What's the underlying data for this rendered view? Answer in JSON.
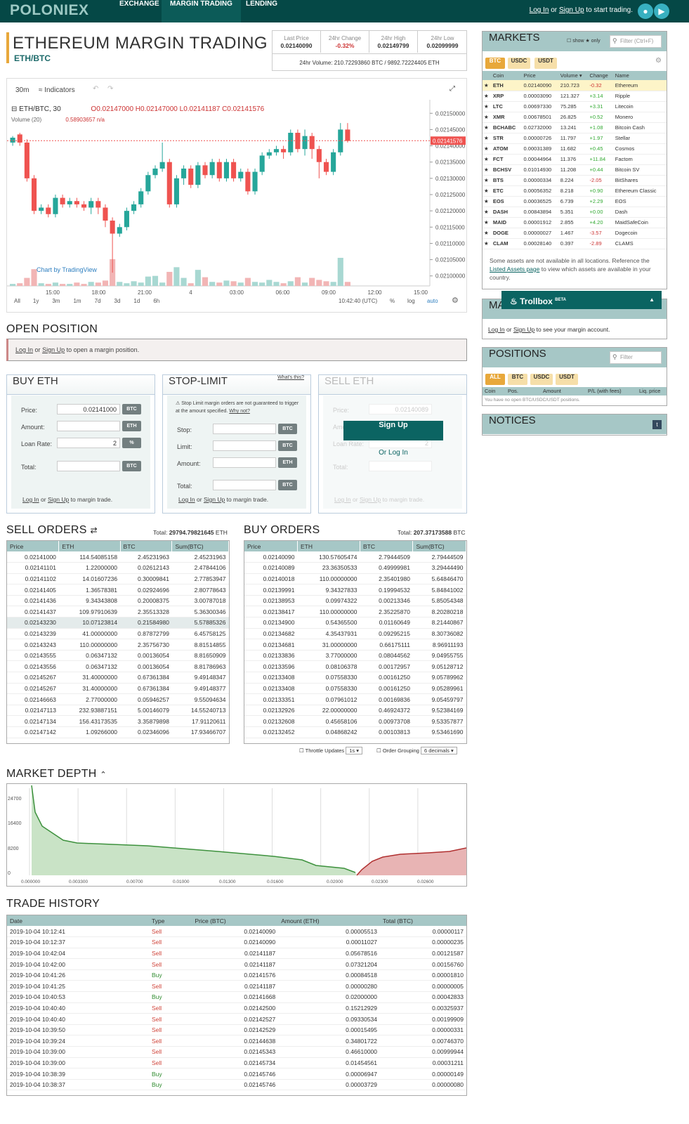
{
  "nav": {
    "logo": "POLONIEX",
    "tabs": [
      "EXCHANGE",
      "MARGIN TRADING",
      "LENDING"
    ],
    "login": "Log In",
    "or": "or",
    "signup": "Sign Up",
    "login_suffix": "to start trading."
  },
  "header": {
    "title": "ETHEREUM MARGIN TRADING",
    "pair": "ETH/BTC",
    "stats": [
      {
        "label": "Last Price",
        "value": "0.02140090"
      },
      {
        "label": "24hr Change",
        "value": "-0.32%"
      },
      {
        "label": "24hr High",
        "value": "0.02149799"
      },
      {
        "label": "24hr Low",
        "value": "0.02099999"
      }
    ],
    "volume": "24hr Volume: 210.72293860 BTC / 9892.72224405 ETH"
  },
  "chart": {
    "interval": "30m",
    "indicators": "Indicators",
    "legend": "ETH/BTC, 30",
    "ohlc": "O0.02147000 H0.02147000 L0.02141187 C0.02141576",
    "volume_label": "Volume (20)",
    "volume_val": "0.58903657 n/a",
    "current_price": "0.02141576",
    "credit": "Chart by TradingView",
    "yticks": [
      "0.02150000",
      "0.02145000",
      "0.02140000",
      "0.02135000",
      "0.02130000",
      "0.02125000",
      "0.02120000",
      "0.02115000",
      "0.02110000",
      "0.02105000",
      "0.02100000"
    ],
    "xticks": [
      "15:00",
      "18:00",
      "21:00",
      "4",
      "03:00",
      "06:00",
      "09:00",
      "12:00",
      "15:00"
    ],
    "ranges": [
      "All",
      "1y",
      "3m",
      "1m",
      "7d",
      "3d",
      "1d",
      "6h"
    ],
    "clock": "10:42:40 (UTC)",
    "pct": "%",
    "log": "log",
    "auto": "auto"
  },
  "open_position": {
    "title": "OPEN POSITION",
    "login": "Log In",
    "or": "or",
    "signup": "Sign Up",
    "text": "to open a margin position."
  },
  "buy": {
    "title": "BUY ETH",
    "price_label": "Price:",
    "price": "0.02141000",
    "amount_label": "Amount:",
    "loan_label": "Loan Rate:",
    "loan": "2",
    "total_label": "Total:",
    "btc": "BTC",
    "eth": "ETH",
    "pct": "%",
    "foot": "to margin trade."
  },
  "stop": {
    "title": "STOP-LIMIT",
    "whats": "What's this?",
    "note": "Stop Limit margin orders are not guaranteed to trigger at the amount specified.",
    "why": "Why not?",
    "stop": "Stop:",
    "limit": "Limit:",
    "amount": "Amount:",
    "total": "Total:"
  },
  "sell": {
    "title": "SELL ETH",
    "signup": "Sign Up",
    "orlogin": "Or Log In",
    "price": "Price:",
    "amount": "Amount:",
    "loan": "Loan Rate:",
    "total": "Total:",
    "priceval": "0.02140089",
    "loanval": "2"
  },
  "sell_orders": {
    "title": "SELL ORDERS",
    "total_label": "Total:",
    "total": "29794.79821645",
    "unit": "ETH",
    "cols": [
      "Price",
      "ETH",
      "BTC",
      "Sum(BTC)"
    ],
    "rows": [
      [
        "0.02141000",
        "114.54085158",
        "2.45231963",
        "2.45231963"
      ],
      [
        "0.02141101",
        "1.22000000",
        "0.02612143",
        "2.47844106"
      ],
      [
        "0.02141102",
        "14.01607236",
        "0.30009841",
        "2.77853947"
      ],
      [
        "0.02141405",
        "1.36578381",
        "0.02924696",
        "2.80778643"
      ],
      [
        "0.02141436",
        "9.34343808",
        "0.20008375",
        "3.00787018"
      ],
      [
        "0.02141437",
        "109.97910639",
        "2.35513328",
        "5.36300346"
      ],
      [
        "0.02143230",
        "10.07123814",
        "0.21584980",
        "5.57885326"
      ],
      [
        "0.02143239",
        "41.00000000",
        "0.87872799",
        "6.45758125"
      ],
      [
        "0.02143243",
        "110.00000000",
        "2.35756730",
        "8.81514855"
      ],
      [
        "0.02143555",
        "0.06347132",
        "0.00136054",
        "8.81650909"
      ],
      [
        "0.02143556",
        "0.06347132",
        "0.00136054",
        "8.81786963"
      ],
      [
        "0.02145267",
        "31.40000000",
        "0.67361384",
        "9.49148347"
      ],
      [
        "0.02145267",
        "31.40000000",
        "0.67361384",
        "9.49148377"
      ],
      [
        "0.02146663",
        "2.77000000",
        "0.05946257",
        "9.55094634"
      ],
      [
        "0.02147113",
        "232.93887151",
        "5.00146079",
        "14.55240713"
      ],
      [
        "0.02147134",
        "156.43173535",
        "3.35879898",
        "17.91120611"
      ],
      [
        "0.02147142",
        "1.09266000",
        "0.02346096",
        "17.93466707"
      ]
    ]
  },
  "buy_orders": {
    "title": "BUY ORDERS",
    "total_label": "Total:",
    "total": "207.37173588",
    "unit": "BTC",
    "cols": [
      "Price",
      "ETH",
      "BTC",
      "Sum(BTC)"
    ],
    "rows": [
      [
        "0.02140090",
        "130.57605474",
        "2.79444509",
        "2.79444509"
      ],
      [
        "0.02140089",
        "23.36350533",
        "0.49999981",
        "3.29444490"
      ],
      [
        "0.02140018",
        "110.00000000",
        "2.35401980",
        "5.64846470"
      ],
      [
        "0.02139991",
        "9.34327833",
        "0.19994532",
        "5.84841002"
      ],
      [
        "0.02138953",
        "0.09974322",
        "0.00213346",
        "5.85054348"
      ],
      [
        "0.02138417",
        "110.00000000",
        "2.35225870",
        "8.20280218"
      ],
      [
        "0.02134900",
        "0.54365500",
        "0.01160649",
        "8.21440867"
      ],
      [
        "0.02134682",
        "4.35437931",
        "0.09295215",
        "8.30736082"
      ],
      [
        "0.02134681",
        "31.00000000",
        "0.66175111",
        "8.96911193"
      ],
      [
        "0.02133836",
        "3.77000000",
        "0.08044562",
        "9.04955755"
      ],
      [
        "0.02133596",
        "0.08106378",
        "0.00172957",
        "9.05128712"
      ],
      [
        "0.02133408",
        "0.07558330",
        "0.00161250",
        "9.05789962"
      ],
      [
        "0.02133408",
        "0.07558330",
        "0.00161250",
        "9.05289961"
      ],
      [
        "0.02133351",
        "0.07961012",
        "0.00169836",
        "9.05459797"
      ],
      [
        "0.02132926",
        "22.00000000",
        "0.46924372",
        "9.52384169"
      ],
      [
        "0.02132608",
        "0.45658106",
        "0.00973708",
        "9.53357877"
      ],
      [
        "0.02132452",
        "0.04868242",
        "0.00103813",
        "9.53461690"
      ]
    ]
  },
  "ob_opts": {
    "throttle": "Throttle Updates",
    "throttle_val": "1s",
    "grouping": "Order Grouping",
    "grouping_val": "6 decimals"
  },
  "depth": {
    "title": "MARKET DEPTH",
    "yticks": [
      "24700",
      "16400",
      "8200",
      "0"
    ],
    "xticks": [
      "0.000000",
      "0.003300",
      "0.00700",
      "0.01000",
      "0.01300",
      "0.01600",
      "0.02000",
      "0.02300",
      "0.02600"
    ]
  },
  "history": {
    "title": "TRADE HISTORY",
    "cols": [
      "Date",
      "Type",
      "Price (BTC)",
      "Amount (ETH)",
      "Total (BTC)"
    ],
    "rows": [
      [
        "2019-10-04 10:12:41",
        "Sell",
        "0.02140090",
        "0.00005513",
        "0.00000117"
      ],
      [
        "2019-10-04 10:12:37",
        "Sell",
        "0.02140090",
        "0.00011027",
        "0.00000235"
      ],
      [
        "2019-10-04 10:42:04",
        "Sell",
        "0.02141187",
        "0.05678516",
        "0.00121587"
      ],
      [
        "2019-10-04 10:42:00",
        "Sell",
        "0.02141187",
        "0.07321204",
        "0.00156760"
      ],
      [
        "2019-10-04 10:41:26",
        "Buy",
        "0.02141576",
        "0.00084518",
        "0.00001810"
      ],
      [
        "2019-10-04 10:41:25",
        "Sell",
        "0.02141187",
        "0.00000280",
        "0.00000005"
      ],
      [
        "2019-10-04 10:40:53",
        "Buy",
        "0.02141668",
        "0.02000000",
        "0.00042833"
      ],
      [
        "2019-10-04 10:40:40",
        "Sell",
        "0.02142500",
        "0.15212929",
        "0.00325937"
      ],
      [
        "2019-10-04 10:40:40",
        "Sell",
        "0.02142527",
        "0.09330534",
        "0.00199909"
      ],
      [
        "2019-10-04 10:39:50",
        "Sell",
        "0.02142529",
        "0.00015495",
        "0.00000331"
      ],
      [
        "2019-10-04 10:39:24",
        "Sell",
        "0.02144638",
        "0.34801722",
        "0.00746370"
      ],
      [
        "2019-10-04 10:39:00",
        "Sell",
        "0.02145343",
        "0.46610000",
        "0.00999944"
      ],
      [
        "2019-10-04 10:39:00",
        "Sell",
        "0.02145734",
        "0.01454561",
        "0.00031211"
      ],
      [
        "2019-10-04 10:38:39",
        "Buy",
        "0.02145746",
        "0.00006947",
        "0.00000149"
      ],
      [
        "2019-10-04 10:38:37",
        "Buy",
        "0.02145746",
        "0.00003729",
        "0.00000080"
      ]
    ]
  },
  "markets": {
    "title": "MARKETS",
    "show_only": "show ★ only",
    "filter": "Filter (Ctrl+F)",
    "tabs": [
      "BTC",
      "USDC",
      "USDT"
    ],
    "cols": [
      "Coin",
      "Price",
      "Volume ▾",
      "Change",
      "Name"
    ],
    "rows": [
      [
        "ETH",
        "0.02140090",
        "210.723",
        "-0.32",
        "Ethereum"
      ],
      [
        "XRP",
        "0.00003090",
        "121.327",
        "+3.14",
        "Ripple"
      ],
      [
        "LTC",
        "0.00697330",
        "75.285",
        "+3.31",
        "Litecoin"
      ],
      [
        "XMR",
        "0.00678501",
        "26.825",
        "+0.52",
        "Monero"
      ],
      [
        "BCHABC",
        "0.02732000",
        "13.241",
        "+1.08",
        "Bitcoin Cash"
      ],
      [
        "STR",
        "0.00000726",
        "11.797",
        "+1.97",
        "Stellar"
      ],
      [
        "ATOM",
        "0.00031389",
        "11.682",
        "+0.45",
        "Cosmos"
      ],
      [
        "FCT",
        "0.00044964",
        "11.376",
        "+11.84",
        "Factom"
      ],
      [
        "BCHSV",
        "0.01014930",
        "11.208",
        "+0.44",
        "Bitcoin SV"
      ],
      [
        "BTS",
        "0.00000334",
        "8.224",
        "-2.05",
        "BitShares"
      ],
      [
        "ETC",
        "0.00056352",
        "8.218",
        "+0.90",
        "Ethereum Classic"
      ],
      [
        "EOS",
        "0.00036525",
        "6.739",
        "+2.29",
        "EOS"
      ],
      [
        "DASH",
        "0.00843894",
        "5.351",
        "+0.00",
        "Dash"
      ],
      [
        "MAID",
        "0.00001912",
        "2.855",
        "+4.20",
        "MaidSafeCoin"
      ],
      [
        "DOGE",
        "0.00000027",
        "1.467",
        "-3.57",
        "Dogecoin"
      ],
      [
        "CLAM",
        "0.00028140",
        "0.397",
        "-2.89",
        "CLAMS"
      ]
    ],
    "note": "Some assets are not available in all locations. Reference the",
    "note_link": "Listed Assets page",
    "note_end": "to view which assets are available in your country."
  },
  "trollbox": {
    "label": "Trollbox",
    "beta": "BETA"
  },
  "margin_account": {
    "title": "MARGIN ACCOUNT",
    "text": "to see your margin account."
  },
  "positions": {
    "title": "POSITIONS",
    "filter": "Filter",
    "tabs": [
      "ALL",
      "BTC",
      "USDC",
      "USDT"
    ],
    "cols": [
      "Coin",
      "Pos.",
      "Amount",
      "P/L (with fees)",
      "Liq. price"
    ],
    "empty": "You have no open BTC/USDC/USDT positions."
  },
  "notices": {
    "title": "NOTICES"
  },
  "candles": [
    [
      2141,
      2142.5,
      2140,
      2143
    ],
    [
      2143.5,
      2141,
      2140,
      2144
    ],
    [
      2141,
      2130,
      2129,
      2142
    ],
    [
      2130,
      2120,
      2119,
      2131
    ],
    [
      2120,
      2121,
      2119,
      2122
    ],
    [
      2121,
      2119,
      2118,
      2122
    ],
    [
      2119,
      2124,
      2118,
      2125
    ],
    [
      2124,
      2122,
      2121,
      2125
    ],
    [
      2122,
      2123,
      2121,
      2124
    ],
    [
      2123,
      2122,
      2121,
      2124
    ],
    [
      2122,
      2121,
      2120,
      2123
    ],
    [
      2121,
      2123,
      2119,
      2124
    ],
    [
      2123,
      2121,
      2119,
      2124
    ],
    [
      2121,
      2117,
      2115,
      2122
    ],
    [
      2117,
      2113,
      2101,
      2118
    ],
    [
      2113,
      2115,
      2112,
      2116
    ],
    [
      2115,
      2120,
      2114,
      2121
    ],
    [
      2120,
      2122,
      2119,
      2123
    ],
    [
      2122,
      2126,
      2121,
      2127
    ],
    [
      2126,
      2131,
      2125,
      2132
    ],
    [
      2131,
      2133,
      2130,
      2134
    ],
    [
      2133,
      2135,
      2132,
      2141
    ],
    [
      2135,
      2122,
      2121,
      2136
    ],
    [
      2122,
      2130,
      2121,
      2131
    ],
    [
      2130,
      2133,
      2128,
      2134
    ],
    [
      2133,
      2128,
      2127,
      2134
    ],
    [
      2128,
      2134,
      2127,
      2135
    ],
    [
      2134,
      2131,
      2130,
      2135
    ],
    [
      2131,
      2135,
      2130,
      2136
    ],
    [
      2135,
      2130,
      2129,
      2136
    ],
    [
      2130,
      2135,
      2129,
      2136
    ],
    [
      2135,
      2130,
      2129,
      2136
    ],
    [
      2130,
      2132,
      2129,
      2133
    ],
    [
      2132,
      2126,
      2125,
      2133
    ],
    [
      2126,
      2132,
      2125,
      2133
    ],
    [
      2132,
      2137,
      2131,
      2138
    ],
    [
      2137,
      2138,
      2136,
      2139
    ],
    [
      2138,
      2139,
      2137,
      2140
    ],
    [
      2139,
      2138,
      2136,
      2140
    ],
    [
      2138,
      2144,
      2137,
      2145
    ],
    [
      2144,
      2139,
      2138,
      2145
    ],
    [
      2139,
      2143,
      2137,
      2145
    ],
    [
      2143,
      2139,
      2136,
      2144
    ],
    [
      2139,
      2135,
      2130,
      2140
    ],
    [
      2135,
      2132,
      2131,
      2136
    ],
    [
      2132,
      2138,
      2131,
      2139
    ],
    [
      2138,
      2145,
      2137,
      2147
    ],
    [
      2145,
      2141.5,
      2141,
      2147
    ]
  ],
  "volumes": [
    0.3,
    0.4,
    1.2,
    2.5,
    0.4,
    0.3,
    0.5,
    0.3,
    0.3,
    0.5,
    0.3,
    0.6,
    0.5,
    0.8,
    4,
    0.6,
    0.4,
    0.7,
    0.5,
    1.4,
    1.5,
    0.5,
    2.1,
    2.8,
    1.2,
    0.4,
    2.4,
    1.3,
    0.6,
    0.5,
    0.8,
    0.7,
    0.5,
    1.2,
    0.6,
    0.5,
    0.9,
    0.6,
    0.4,
    0.7,
    1.3,
    0.5,
    1.2,
    0.9,
    0.7,
    0.6,
    4.2,
    0.6
  ]
}
